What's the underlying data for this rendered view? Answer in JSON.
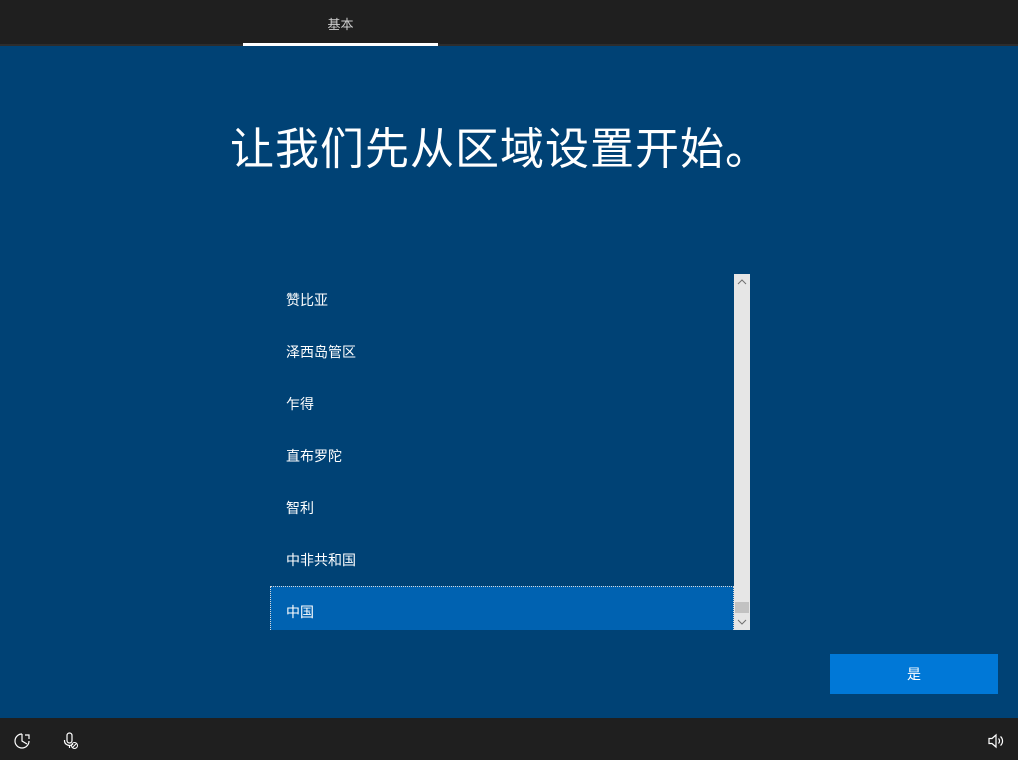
{
  "header": {
    "tab_label": "基本"
  },
  "main": {
    "heading": "让我们先从区域设置开始。",
    "regions": [
      {
        "label": "赞比亚",
        "selected": false
      },
      {
        "label": "泽西岛管区",
        "selected": false
      },
      {
        "label": "乍得",
        "selected": false
      },
      {
        "label": "直布罗陀",
        "selected": false
      },
      {
        "label": "智利",
        "selected": false
      },
      {
        "label": "中非共和国",
        "selected": false
      },
      {
        "label": "中国",
        "selected": true
      }
    ]
  },
  "footer": {
    "yes_label": "是",
    "icons": [
      "ease-of-access-icon",
      "microphone-icon",
      "volume-icon"
    ]
  },
  "colors": {
    "background": "#004275",
    "selected_item": "#0062b1",
    "button": "#0078d7",
    "bar": "#1f1f1f"
  }
}
